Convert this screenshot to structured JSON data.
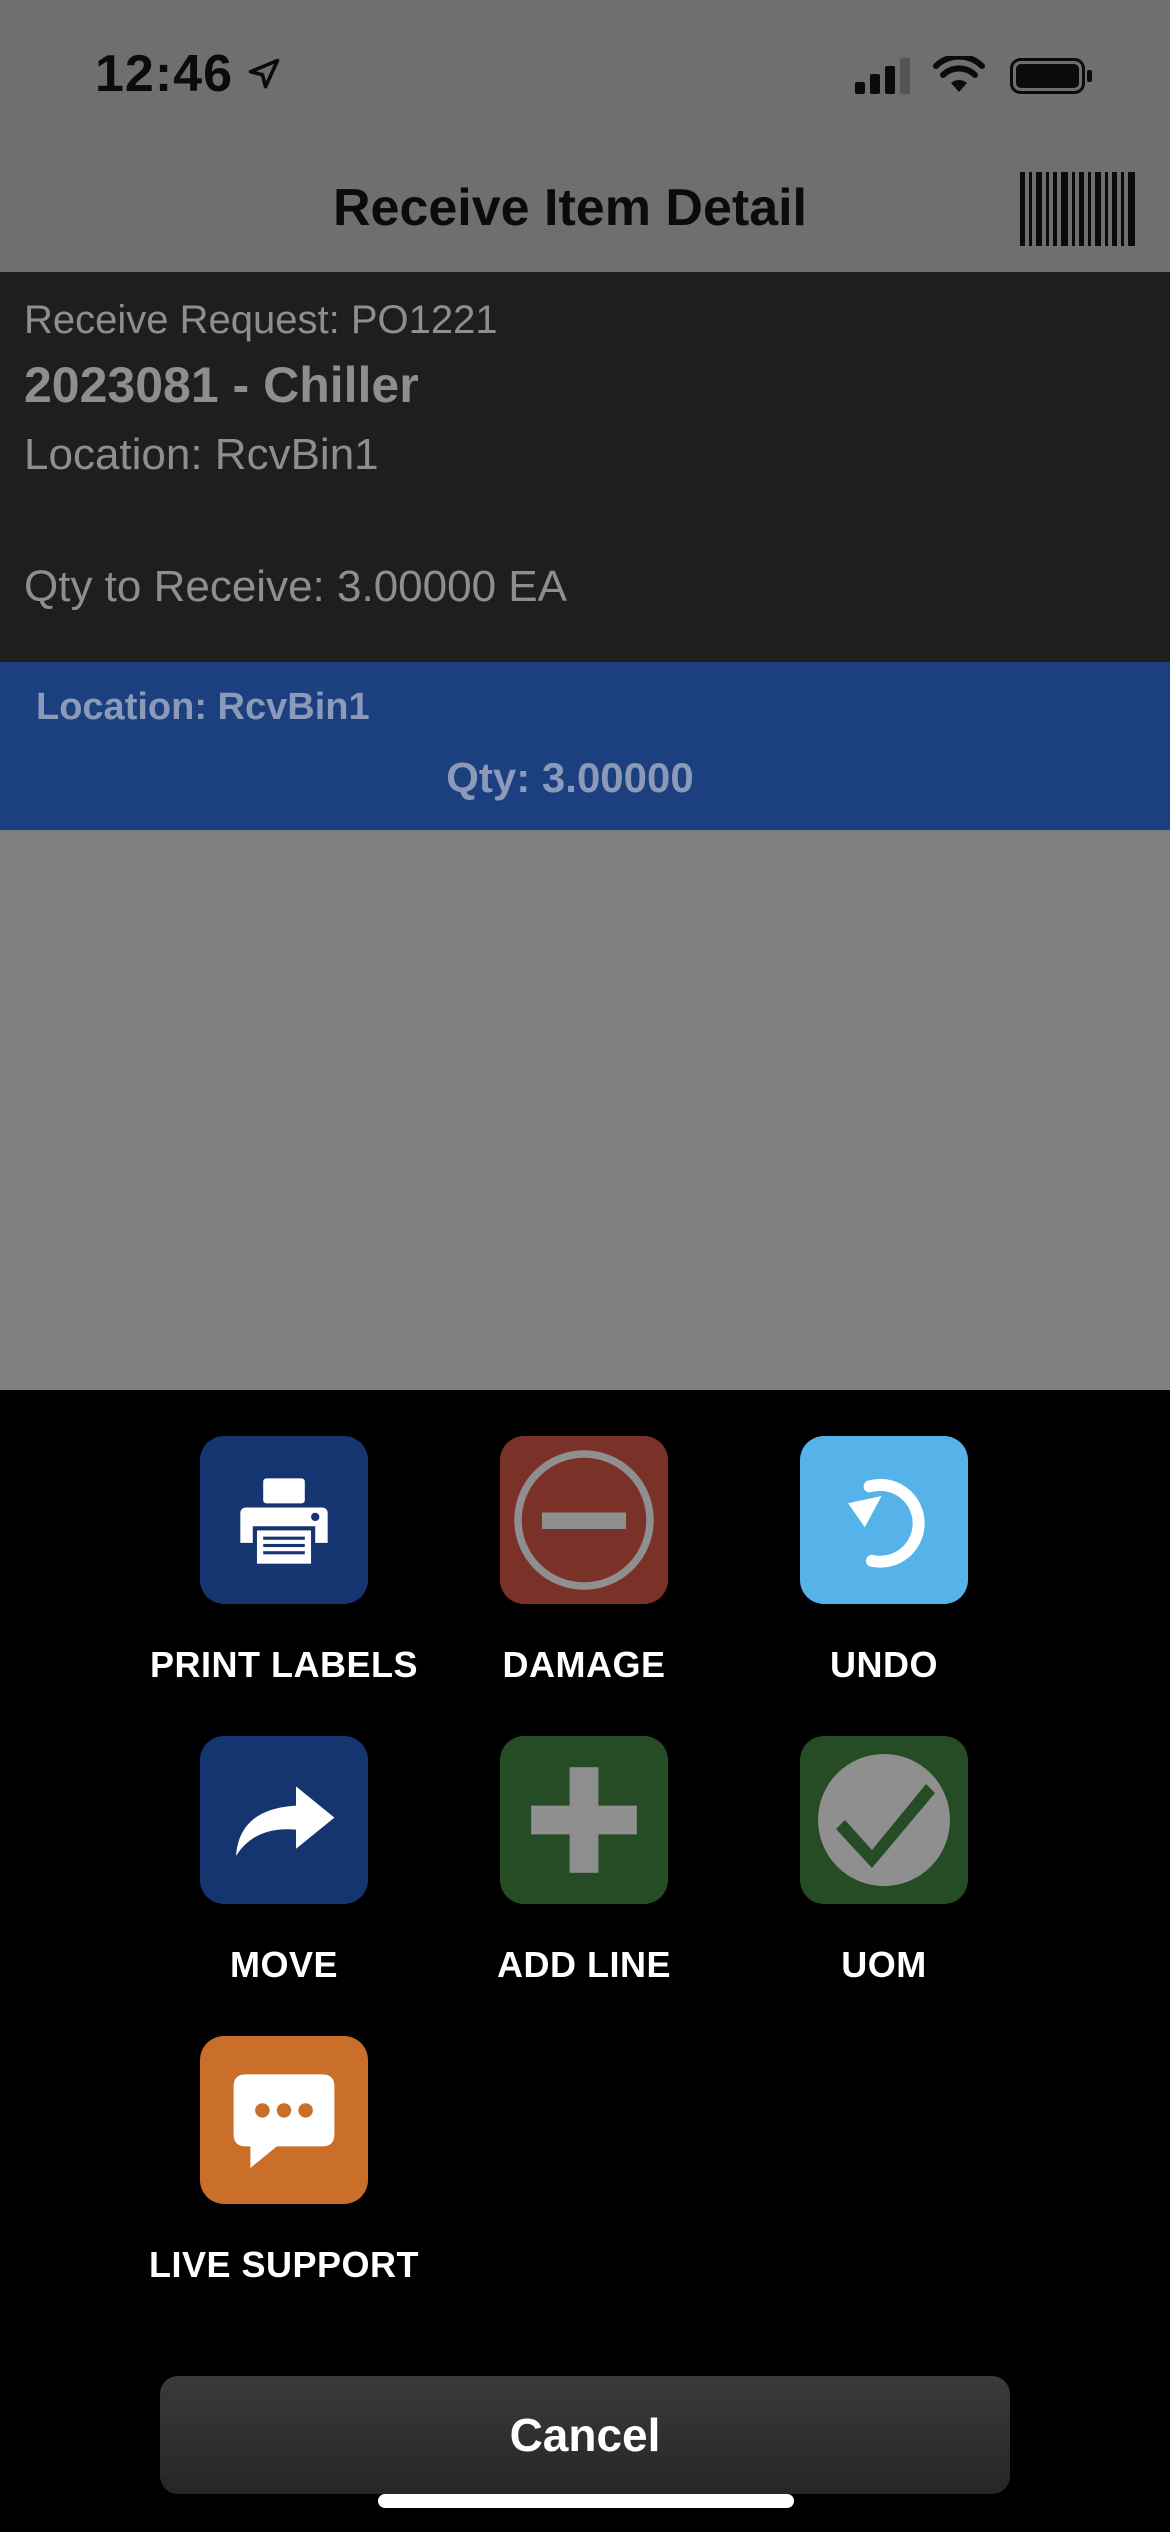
{
  "status_bar": {
    "time": "12:46"
  },
  "header": {
    "title": "Receive Item Detail"
  },
  "detail": {
    "receive_request": "Receive Request: PO1221",
    "item": "2023081 - Chiller",
    "location": "Location: RcvBin1",
    "qty_to_receive": "Qty to Receive: 3.00000 EA"
  },
  "line": {
    "location": "Location: RcvBin1",
    "qty": "Qty:  3.00000"
  },
  "actions": [
    {
      "label": "PRINT LABELS",
      "icon": "printer-icon",
      "color": "#14356f"
    },
    {
      "label": "DAMAGE",
      "icon": "minus-circle-icon",
      "color": "#7a3128"
    },
    {
      "label": "UNDO",
      "icon": "undo-icon",
      "color": "#55b3ea"
    },
    {
      "label": "MOVE",
      "icon": "forward-arrow-icon",
      "color": "#14356f"
    },
    {
      "label": "ADD LINE",
      "icon": "plus-icon",
      "color": "#254c24"
    },
    {
      "label": "UOM",
      "icon": "check-circle-icon",
      "color": "#254c24"
    },
    {
      "label": "LIVE SUPPORT",
      "icon": "chat-bubble-icon",
      "color": "#c96f2a"
    }
  ],
  "cancel_label": "Cancel"
}
